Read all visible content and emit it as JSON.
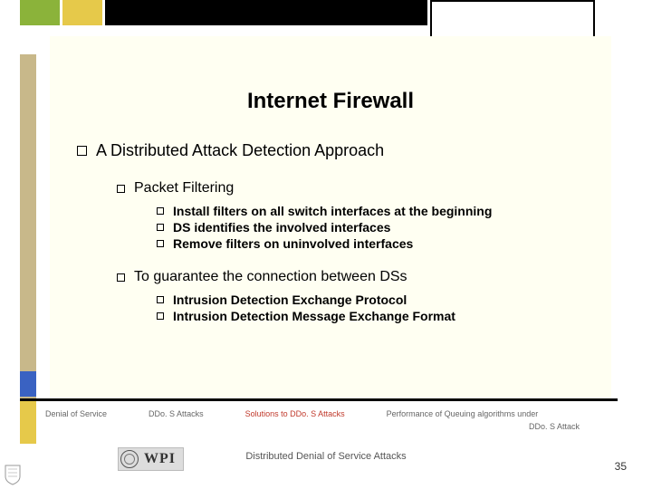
{
  "title": "Internet Firewall",
  "lvl1": "A Distributed Attack Detection Approach",
  "section1": {
    "heading": "Packet Filtering",
    "items": [
      "Install filters on all switch interfaces at the beginning",
      "DS identifies the involved interfaces",
      "Remove filters on uninvolved interfaces"
    ]
  },
  "section2": {
    "heading": "To guarantee the connection between DSs",
    "items": [
      "Intrusion Detection Exchange Protocol",
      "Intrusion Detection Message Exchange Format"
    ]
  },
  "footer_nav": {
    "items": [
      "Denial of Service",
      "DDo. S Attacks",
      "Solutions to DDo. S Attacks",
      "Performance of Queuing algorithms under"
    ],
    "extra": "DDo. S Attack",
    "active_index": 2
  },
  "footer_title": "Distributed Denial of Service Attacks",
  "logo_text": "WPI",
  "page_number": "35"
}
